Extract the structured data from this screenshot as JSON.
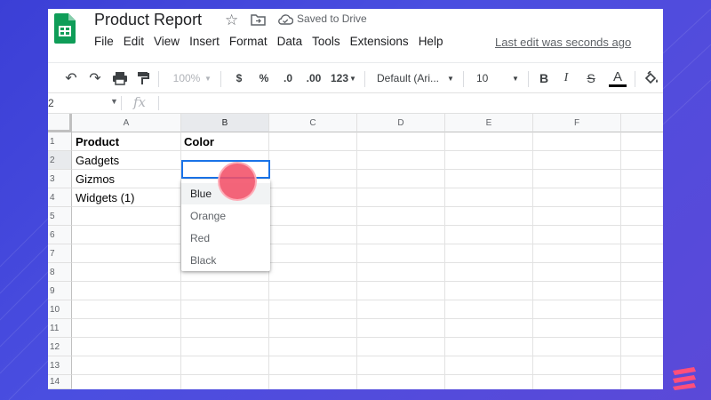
{
  "app": {
    "title": "Product Report",
    "saved_status": "Saved to Drive",
    "last_edit": "Last edit was seconds ago"
  },
  "menu": [
    "File",
    "Edit",
    "View",
    "Insert",
    "Format",
    "Data",
    "Tools",
    "Extensions",
    "Help"
  ],
  "toolbar": {
    "zoom": "100%",
    "currency": "$",
    "percent": "%",
    "decrease_decimal": ".0",
    "increase_decimal": ".00",
    "more_formats": "123",
    "font": "Default (Ari...",
    "font_size": "10",
    "bold": "B",
    "italic": "I",
    "strike": "S",
    "text_color": "A"
  },
  "formula_bar": {
    "name_box": "2",
    "fx_label": "fx"
  },
  "columns": [
    "A",
    "B",
    "C",
    "D",
    "E",
    "F"
  ],
  "rows": [
    "1",
    "2",
    "3",
    "4",
    "5",
    "6",
    "7",
    "8",
    "9",
    "10",
    "11",
    "12",
    "13",
    "14"
  ],
  "cells": {
    "a1": "Product",
    "b1": "Color",
    "a2": "Gadgets",
    "a3": "Gizmos",
    "a4": "Widgets (1)"
  },
  "dropdown": {
    "options": [
      "Blue",
      "Orange",
      "Red",
      "Black"
    ],
    "highlighted": "Blue"
  },
  "colors": {
    "background": "#3b3fd6",
    "sheets_green": "#0f9d58",
    "selection_blue": "#1a73e8",
    "click_indicator": "#f25068",
    "brand_pink": "#ff4f7b"
  }
}
